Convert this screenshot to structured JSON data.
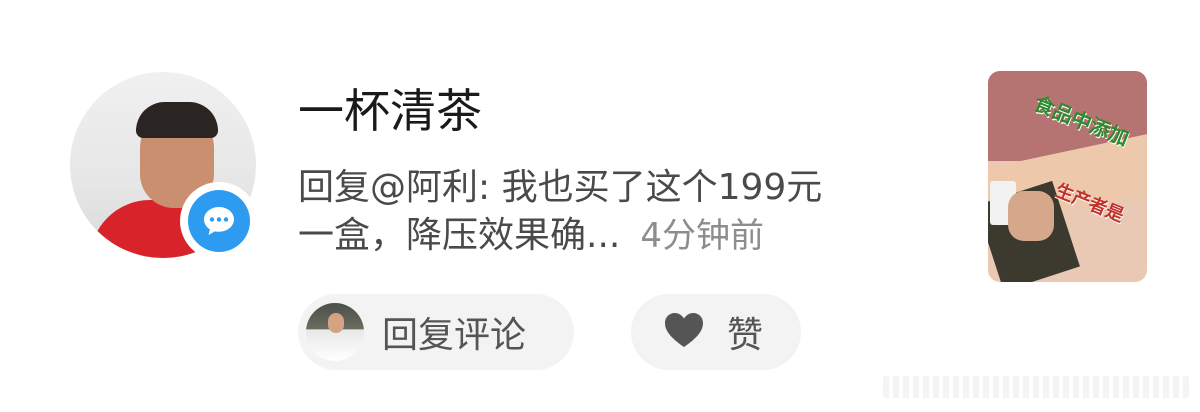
{
  "comment": {
    "username": "一杯清茶",
    "reply_line1": "回复@阿利: 我也买了这个199元",
    "reply_line2": "一盒，降压效果确...",
    "timestamp": "4分钟前",
    "avatar_badge_icon": "chat-bubble-icon",
    "badge_color": "#2c9bf0"
  },
  "thumbnail": {
    "caption_line1": "食品中添加",
    "caption_line2": "生产者是"
  },
  "actions": {
    "reply_label": "回复评论",
    "like_label": "赞",
    "like_icon": "heart-icon"
  }
}
